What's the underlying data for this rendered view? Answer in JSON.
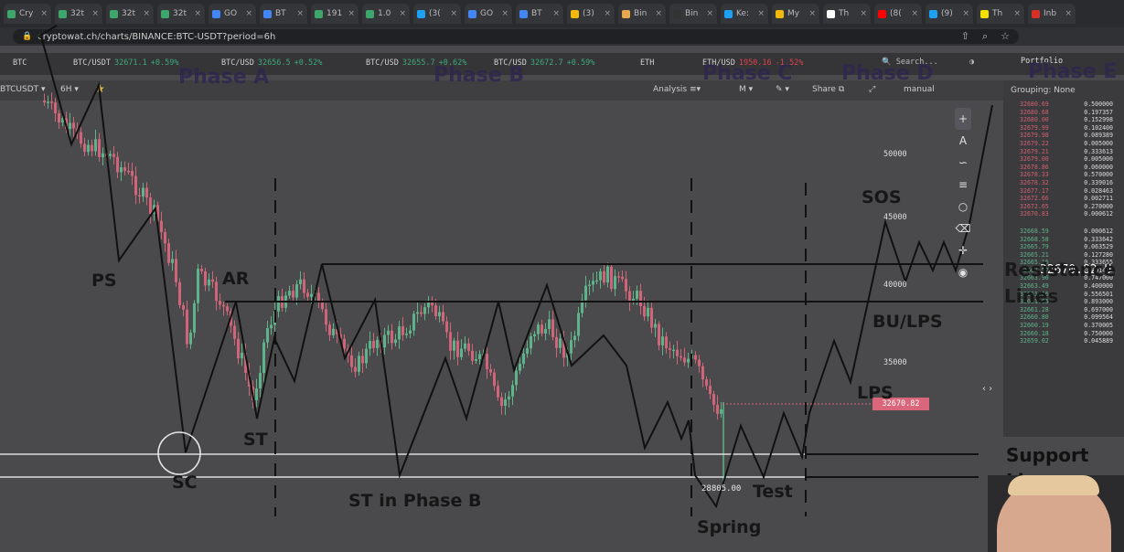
{
  "browser": {
    "tabs": [
      {
        "title": "Cry",
        "color": "#3fa66b"
      },
      {
        "title": "32t",
        "color": "#3fa66b"
      },
      {
        "title": "32t",
        "color": "#3fa66b"
      },
      {
        "title": "32t",
        "color": "#3fa66b"
      },
      {
        "title": "GO",
        "color": "#4285f4"
      },
      {
        "title": "BT",
        "color": "#4285f4"
      },
      {
        "title": "191",
        "color": "#3fa66b"
      },
      {
        "title": "1.0",
        "color": "#3fa66b"
      },
      {
        "title": "(3(",
        "color": "#1da1f2"
      },
      {
        "title": "GO",
        "color": "#4285f4"
      },
      {
        "title": "BT",
        "color": "#4285f4"
      },
      {
        "title": "(3)",
        "color": "#f0b90b"
      },
      {
        "title": "Bin",
        "color": "#e8a84d"
      },
      {
        "title": "Bin",
        "color": "#333333"
      },
      {
        "title": "Ke:",
        "color": "#1da1f2"
      },
      {
        "title": "My",
        "color": "#f0b90b"
      },
      {
        "title": "Th",
        "color": "#ffffff"
      },
      {
        "title": "(8(",
        "color": "#ff0000"
      },
      {
        "title": "(9)",
        "color": "#1da1f2"
      },
      {
        "title": "Th",
        "color": "#f5e000"
      },
      {
        "title": "Inb",
        "color": "#d93025"
      }
    ],
    "url": "cryptowat.ch/charts/BINANCE:BTC-USDT?period=6h"
  },
  "ticker": [
    {
      "symbol": "BTC",
      "price": "",
      "change": ""
    },
    {
      "symbol": "BTC/USDT",
      "price": "32671.1",
      "change": "+0.59%",
      "dir": "up"
    },
    {
      "symbol": "BTC/USD",
      "price": "32656.5",
      "change": "+0.52%",
      "dir": "up"
    },
    {
      "symbol": "BTC/USD",
      "price": "32655.7",
      "change": "+0.62%",
      "dir": "up"
    },
    {
      "symbol": "BTC/USD",
      "price": "32672.7",
      "change": "+0.59%",
      "dir": "up"
    },
    {
      "symbol": "ETH",
      "price": "",
      "change": ""
    },
    {
      "symbol": "ETH/USD",
      "price": "1950.16",
      "change": "-1.52%",
      "dir": "down"
    }
  ],
  "header": {
    "search_placeholder": "Search...",
    "portfolio": "Portfolio"
  },
  "toolbar": {
    "pair": "BTCUSDT",
    "period": "6H",
    "analysis": "Analysis",
    "m": "M",
    "share": "Share",
    "manual": "manual"
  },
  "orderbook": {
    "grouping": "Grouping: None",
    "asks": [
      [
        "32680.69",
        "0.500000"
      ],
      [
        "32680.68",
        "0.197357"
      ],
      [
        "32680.00",
        "0.152998"
      ],
      [
        "32679.99",
        "0.102400"
      ],
      [
        "32679.98",
        "0.089389"
      ],
      [
        "32679.22",
        "0.005000"
      ],
      [
        "32679.21",
        "0.333613"
      ],
      [
        "32679.00",
        "0.005000"
      ],
      [
        "32678.86",
        "0.060000"
      ],
      [
        "32678.33",
        "0.570000"
      ],
      [
        "32678.32",
        "0.339016"
      ],
      [
        "32677.17",
        "0.028463"
      ],
      [
        "32672.66",
        "0.002711"
      ],
      [
        "32672.65",
        "0.270000"
      ],
      [
        "32670.83",
        "0.000612"
      ]
    ],
    "bids": [
      [
        "32668.59",
        "0.000612"
      ],
      [
        "32668.58",
        "0.333642"
      ],
      [
        "32665.79",
        "0.063529"
      ],
      [
        "32665.21",
        "0.127280"
      ],
      [
        "32665.16",
        "0.333655"
      ],
      [
        "32663.97",
        "0.401452"
      ],
      [
        "32663.96",
        "0.747000"
      ],
      [
        "32663.49",
        "0.400000"
      ],
      [
        "32661.66",
        "0.556501"
      ],
      [
        "32661.65",
        "0.893000"
      ],
      [
        "32661.28",
        "0.697000"
      ],
      [
        "32660.80",
        "0.099564"
      ],
      [
        "32660.19",
        "0.370005"
      ],
      [
        "32660.18",
        "0.750000"
      ],
      [
        "32659.02",
        "0.045889"
      ]
    ]
  },
  "yaxis": {
    "ticks": [
      "50000",
      "45000",
      "40000",
      "35000"
    ],
    "last_price_badge": "32670.82",
    "cursor_price": "32670.82 U",
    "low_label": "28805.00"
  },
  "annotations": {
    "phases": [
      "Phase A",
      "Phase B",
      "Phase C",
      "Phase D",
      "Phase E"
    ],
    "PS": "PS",
    "AR": "AR",
    "SC": "SC",
    "ST": "ST",
    "ST_B": "ST in Phase B",
    "Spring": "Spring",
    "Test": "Test",
    "LPS": "LPS",
    "BU_LPS": "BU/LPS",
    "SOS": "SOS",
    "resistance": [
      "Resistance",
      "Lines"
    ],
    "support": [
      "Support",
      "Lines"
    ]
  },
  "tools": [
    "plus-icon",
    "text-icon",
    "brush-icon",
    "fib-icon",
    "circle-icon",
    "trash-icon",
    "crosshair-icon",
    "eye-icon"
  ],
  "colors": {
    "bull": "#5fb38a",
    "bear": "#d06478",
    "line": "#111111"
  }
}
